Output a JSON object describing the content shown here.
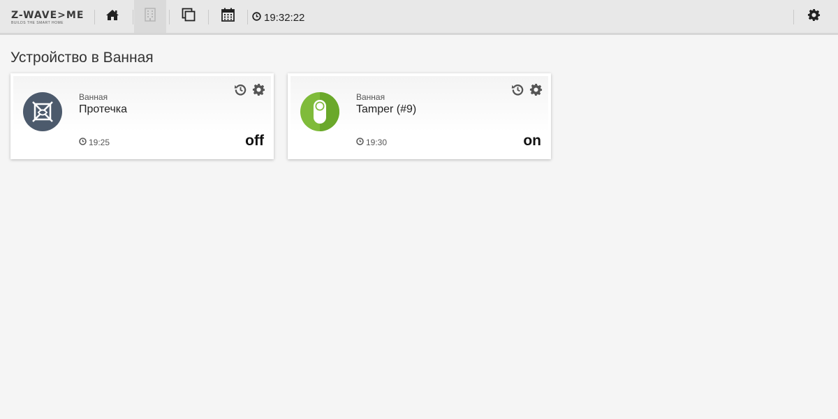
{
  "header": {
    "logo_text": "Z-WAVE>ME",
    "logo_tagline": "BUILDS THE SMART HOME",
    "nav": [
      {
        "name": "home",
        "icon": "home-icon",
        "active": false
      },
      {
        "name": "rooms",
        "icon": "building-icon",
        "active": true
      },
      {
        "name": "elements",
        "icon": "clone-icon",
        "active": false
      },
      {
        "name": "events",
        "icon": "calendar-icon",
        "active": false
      }
    ],
    "clock": "19:32:22",
    "settings_icon": "gear-icon"
  },
  "page": {
    "title": "Устройство в Ванная"
  },
  "cards": [
    {
      "room": "Ванная",
      "name": "Протечка",
      "time": "19:25",
      "level": "off",
      "icon": "flood-sensor-off-icon",
      "icon_color": "#4c5a6c"
    },
    {
      "room": "Ванная",
      "name": "Tamper (#9)",
      "time": "19:30",
      "level": "on",
      "icon": "tamper-on-icon",
      "icon_color": "#7fbb3a"
    }
  ],
  "colors": {
    "topbar_bg": "#e8e8e8",
    "active_nav_bg": "#dadada",
    "page_bg": "#f5f5f5",
    "icon_gray": "#555555"
  }
}
